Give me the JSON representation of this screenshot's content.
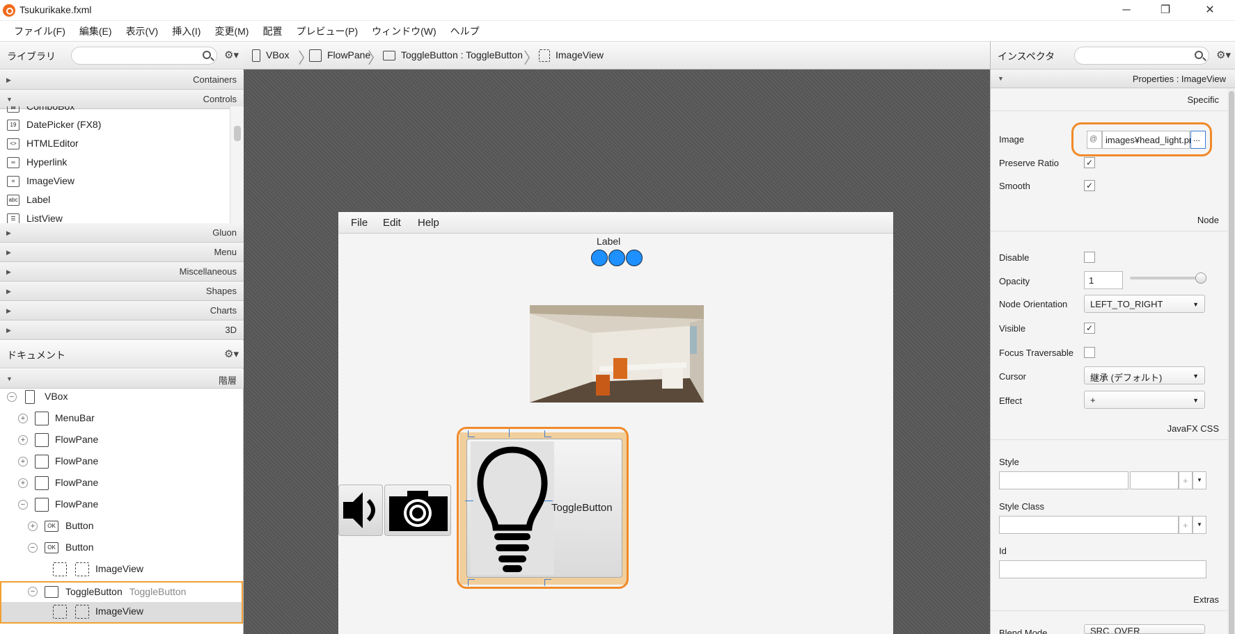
{
  "window": {
    "title": "Tsukurikake.fxml",
    "minimize": "─",
    "maximize": "❐",
    "close": "✕"
  },
  "menubar": [
    "ファイル(F)",
    "編集(E)",
    "表示(V)",
    "挿入(I)",
    "変更(M)",
    "配置",
    "プレビュー(P)",
    "ウィンドウ(W)",
    "ヘルプ"
  ],
  "library": {
    "title": "ライブラリ",
    "categories_top": [
      "Containers",
      "Controls"
    ],
    "items": [
      "ComboBox",
      "DatePicker  (FX8)",
      "HTMLEditor",
      "Hyperlink",
      "ImageView",
      "Label",
      "ListView"
    ],
    "item_icons": [
      "▤",
      "19",
      "<>",
      "∞",
      "⌗",
      "abc",
      "☰"
    ],
    "categories_bottom": [
      "Gluon",
      "Menu",
      "Miscellaneous",
      "Shapes",
      "Charts",
      "3D"
    ]
  },
  "document": {
    "title": "ドキュメント",
    "hierarchy_label": "階層",
    "tree": [
      {
        "label": "VBox",
        "sub": ""
      },
      {
        "label": "MenuBar",
        "sub": ""
      },
      {
        "label": "FlowPane",
        "sub": ""
      },
      {
        "label": "FlowPane",
        "sub": ""
      },
      {
        "label": "FlowPane",
        "sub": ""
      },
      {
        "label": "FlowPane",
        "sub": ""
      },
      {
        "label": "Button",
        "sub": ""
      },
      {
        "label": "Button",
        "sub": ""
      },
      {
        "label": "ImageView",
        "sub": ""
      },
      {
        "label": "ToggleButton",
        "sub": "ToggleButton"
      },
      {
        "label": "ImageView",
        "sub": ""
      }
    ]
  },
  "breadcrumbs": [
    "VBox",
    "FlowPane",
    "ToggleButton : ToggleButton",
    "ImageView"
  ],
  "canvas": {
    "menus": [
      "File",
      "Edit",
      "Help"
    ],
    "label": "Label",
    "toggle_label": "ToggleButton"
  },
  "inspector": {
    "title": "インスペクタ",
    "properties_header": "Properties : ImageView",
    "sections": {
      "specific": "Specific",
      "node": "Node",
      "css": "JavaFX CSS",
      "extras": "Extras"
    },
    "image_label": "Image",
    "image_prefix": "@",
    "image_value": "images¥head_light.pr",
    "image_browse": "...",
    "preserve_ratio": "Preserve Ratio",
    "smooth": "Smooth",
    "disable": "Disable",
    "opacity": "Opacity",
    "opacity_value": "1",
    "opacity_slider_fraction": 1.0,
    "node_orientation": "Node Orientation",
    "node_orientation_value": "LEFT_TO_RIGHT",
    "visible": "Visible",
    "focus_traversable": "Focus Traversable",
    "cursor": "Cursor",
    "cursor_value": "継承 (デフォルト)",
    "effect": "Effect",
    "effect_value": "+",
    "style": "Style",
    "style_class": "Style Class",
    "id": "Id",
    "blend_mode": "Blend Mode",
    "blend_mode_value": "SRC_OVER",
    "checked": "✓"
  },
  "colors": {
    "accent": "#f08a2a",
    "circle": "#1e90ff",
    "selection": "#3a7bd5"
  }
}
